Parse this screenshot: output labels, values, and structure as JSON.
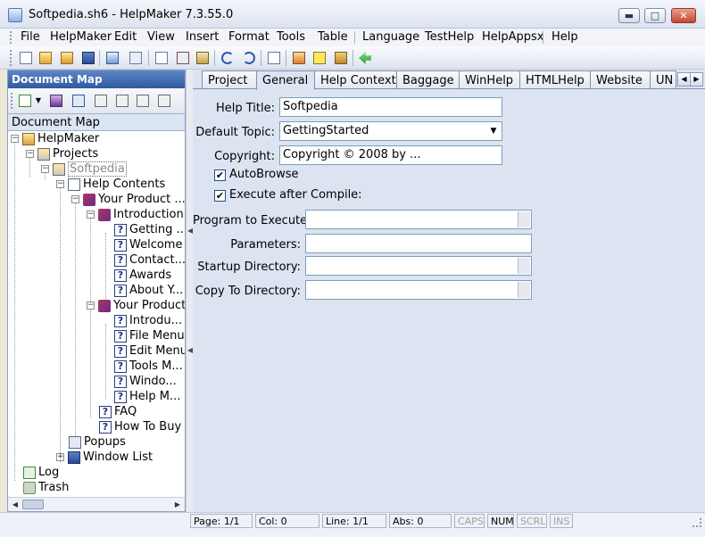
{
  "window": {
    "title": "Softpedia.sh6 - HelpMaker 7.3.55.0",
    "min_label": "▬",
    "max_label": "□",
    "close_label": "✕"
  },
  "menu": {
    "items": [
      "File",
      "HelpMaker",
      "Edit",
      "View",
      "Insert",
      "Format",
      "Tools",
      "Table",
      "Language",
      "TestHelp",
      "HelpAppsx",
      "Help"
    ]
  },
  "toolbar": {
    "icons": [
      "new-icon",
      "open-icon",
      "open-folder-icon",
      "save-icon",
      "project-icon",
      "spellcheck-icon",
      "copy-icon",
      "cut-icon",
      "paste-icon",
      "undo-icon",
      "redo-icon",
      "properties-icon",
      "compile-icon",
      "help-icon",
      "book-icon",
      "back-arrow-icon"
    ]
  },
  "document_map": {
    "header": "Document Map",
    "title": "Document Map",
    "tree": [
      {
        "label": "HelpMaker",
        "level": 0,
        "icon": "home-icon",
        "expander": "−"
      },
      {
        "label": "Projects",
        "level": 1,
        "icon": "projects-icon",
        "expander": "−"
      },
      {
        "label": "Softpedia",
        "level": 2,
        "icon": "project-icon",
        "expander": "−",
        "selected": true
      },
      {
        "label": "Help Contents",
        "level": 3,
        "icon": "contents-icon",
        "expander": "−"
      },
      {
        "label": "Your Product ...",
        "level": 4,
        "icon": "book-icon",
        "expander": "−"
      },
      {
        "label": "Introduction",
        "level": 5,
        "icon": "book-icon",
        "expander": "−"
      },
      {
        "label": "Getting ...",
        "level": 6,
        "icon": "topic-icon"
      },
      {
        "label": "Welcome",
        "level": 6,
        "icon": "topic-icon"
      },
      {
        "label": "Contact...",
        "level": 6,
        "icon": "topic-icon"
      },
      {
        "label": "Awards",
        "level": 6,
        "icon": "topic-icon"
      },
      {
        "label": "About Y...",
        "level": 6,
        "icon": "topic-icon"
      },
      {
        "label": "Your Product",
        "level": 5,
        "icon": "book-icon",
        "expander": "−"
      },
      {
        "label": "Introdu...",
        "level": 6,
        "icon": "topic-icon"
      },
      {
        "label": "File Menu",
        "level": 6,
        "icon": "topic-icon"
      },
      {
        "label": "Edit Menu",
        "level": 6,
        "icon": "topic-icon"
      },
      {
        "label": "Tools M...",
        "level": 6,
        "icon": "topic-icon"
      },
      {
        "label": "Windo...",
        "level": 6,
        "icon": "topic-icon"
      },
      {
        "label": "Help M...",
        "level": 6,
        "icon": "topic-icon"
      },
      {
        "label": "FAQ",
        "level": 5,
        "icon": "topic-icon"
      },
      {
        "label": "How To Buy",
        "level": 5,
        "icon": "topic-icon"
      },
      {
        "label": "Popups",
        "level": 3,
        "icon": "popups-icon"
      },
      {
        "label": "Window List",
        "level": 3,
        "icon": "window-list-icon",
        "expander": "+"
      },
      {
        "label": "Log",
        "level": 0,
        "icon": "log-icon"
      },
      {
        "label": "Trash",
        "level": 0,
        "icon": "trash-icon"
      }
    ]
  },
  "tabs": {
    "items": [
      "Project",
      "General",
      "Help Context",
      "Baggage",
      "WinHelp",
      "HTMLHelp",
      "Website",
      "UN"
    ],
    "active": "General"
  },
  "general": {
    "help_title_label": "Help Title:",
    "help_title_value": "Softpedia",
    "default_topic_label": "Default Topic:",
    "default_topic_value": "GettingStarted",
    "copyright_label": "Copyright:",
    "copyright_value": "Copyright © 2008 by ...",
    "autobrowse_label": "AutoBrowse",
    "autobrowse_checked": true,
    "execute_label": "Execute after Compile:",
    "execute_checked": true,
    "program_label": "Program to Execute:",
    "program_value": "",
    "parameters_label": "Parameters:",
    "parameters_value": "",
    "startup_label": "Startup Directory:",
    "startup_value": "",
    "copyto_label": "Copy To Directory:",
    "copyto_value": ""
  },
  "status": {
    "page": "Page: 1/1",
    "col": "Col: 0",
    "line": "Line: 1/1",
    "abs": "Abs: 0",
    "caps": "CAPS",
    "num": "NUM",
    "scrl": "SCRL",
    "ins": "INS"
  }
}
